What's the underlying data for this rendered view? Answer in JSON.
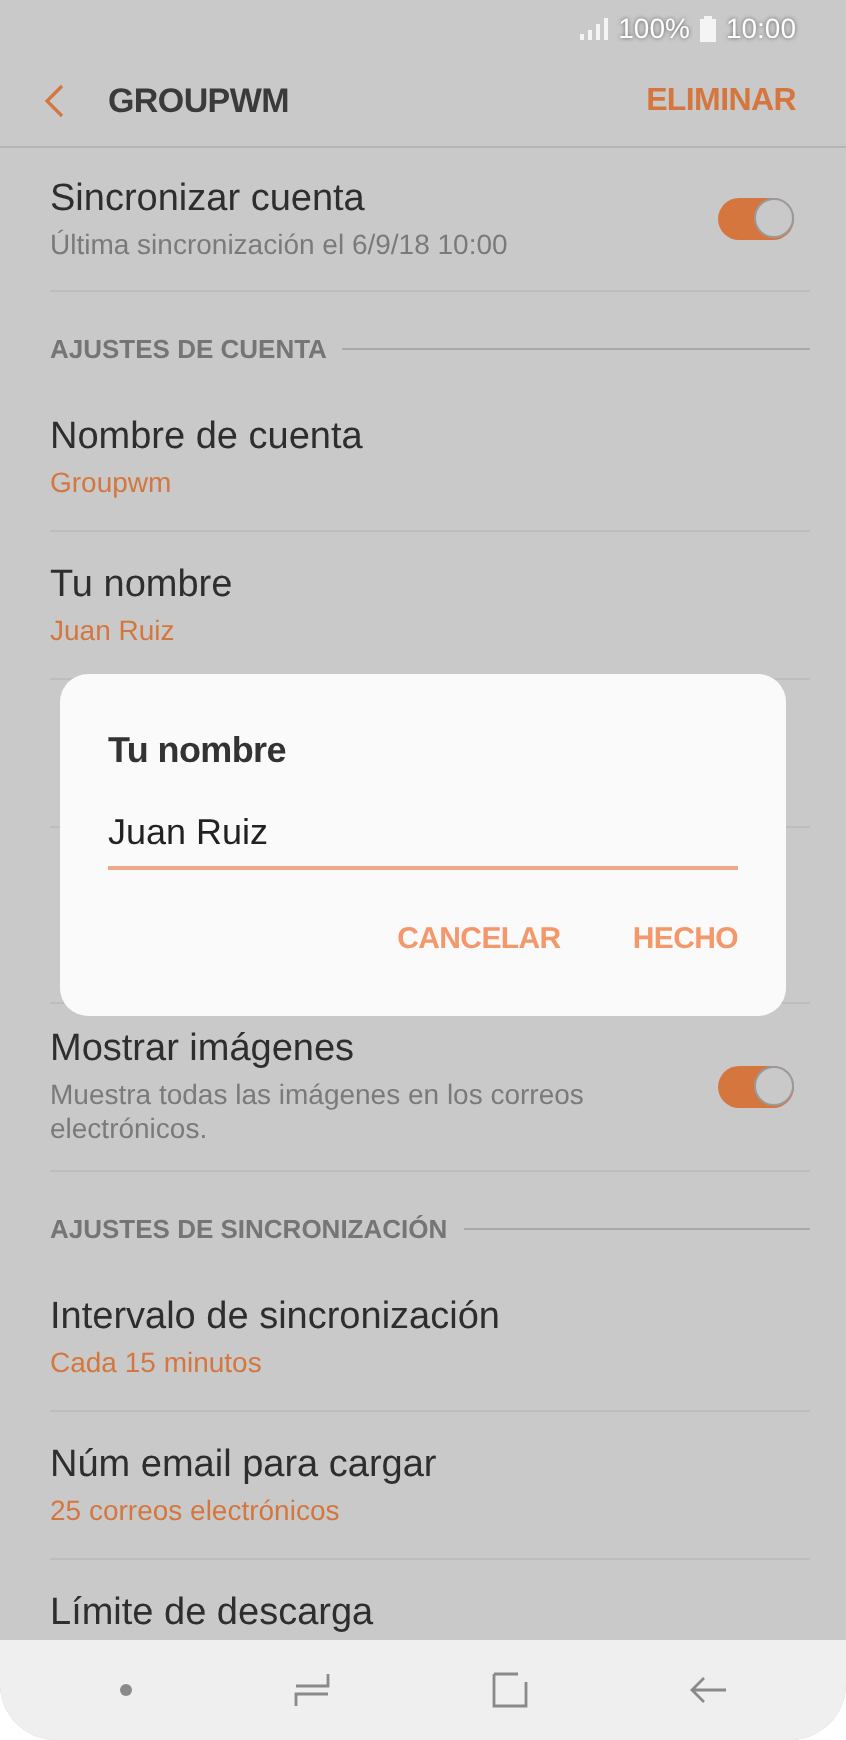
{
  "status_bar": {
    "battery": "100%",
    "time": "10:00"
  },
  "header": {
    "title": "GROUPWM",
    "action": "ELIMINAR"
  },
  "items": [
    {
      "kind": "toggle",
      "title": "Sincronizar cuenta",
      "subtitle": "Última sincronización el 6/9/18  10:00",
      "on": true
    },
    {
      "kind": "section",
      "title": "AJUSTES DE CUENTA"
    },
    {
      "kind": "value",
      "title": "Nombre de cuenta",
      "subtitle": "Groupwm"
    },
    {
      "kind": "value",
      "title": "Tu nombre",
      "subtitle": "Juan Ruiz"
    },
    {
      "kind": "covered"
    },
    {
      "kind": "covered"
    },
    {
      "kind": "toggle",
      "title": "Mostrar imágenes",
      "subtitle": "Muestra todas las imágenes en los correos electrónicos.",
      "on": true
    },
    {
      "kind": "section",
      "title": "AJUSTES DE SINCRONIZACIÓN"
    },
    {
      "kind": "value",
      "title": "Intervalo de sincronización",
      "subtitle": "Cada 15 minutos"
    },
    {
      "kind": "value",
      "title": "Núm email para cargar",
      "subtitle": "25 correos electrónicos"
    },
    {
      "kind": "value",
      "title": "Límite de descarga"
    }
  ],
  "dialog": {
    "title": "Tu nombre",
    "value": "Juan Ruiz",
    "buttons": [
      "CANCELAR",
      "HECHO"
    ]
  }
}
